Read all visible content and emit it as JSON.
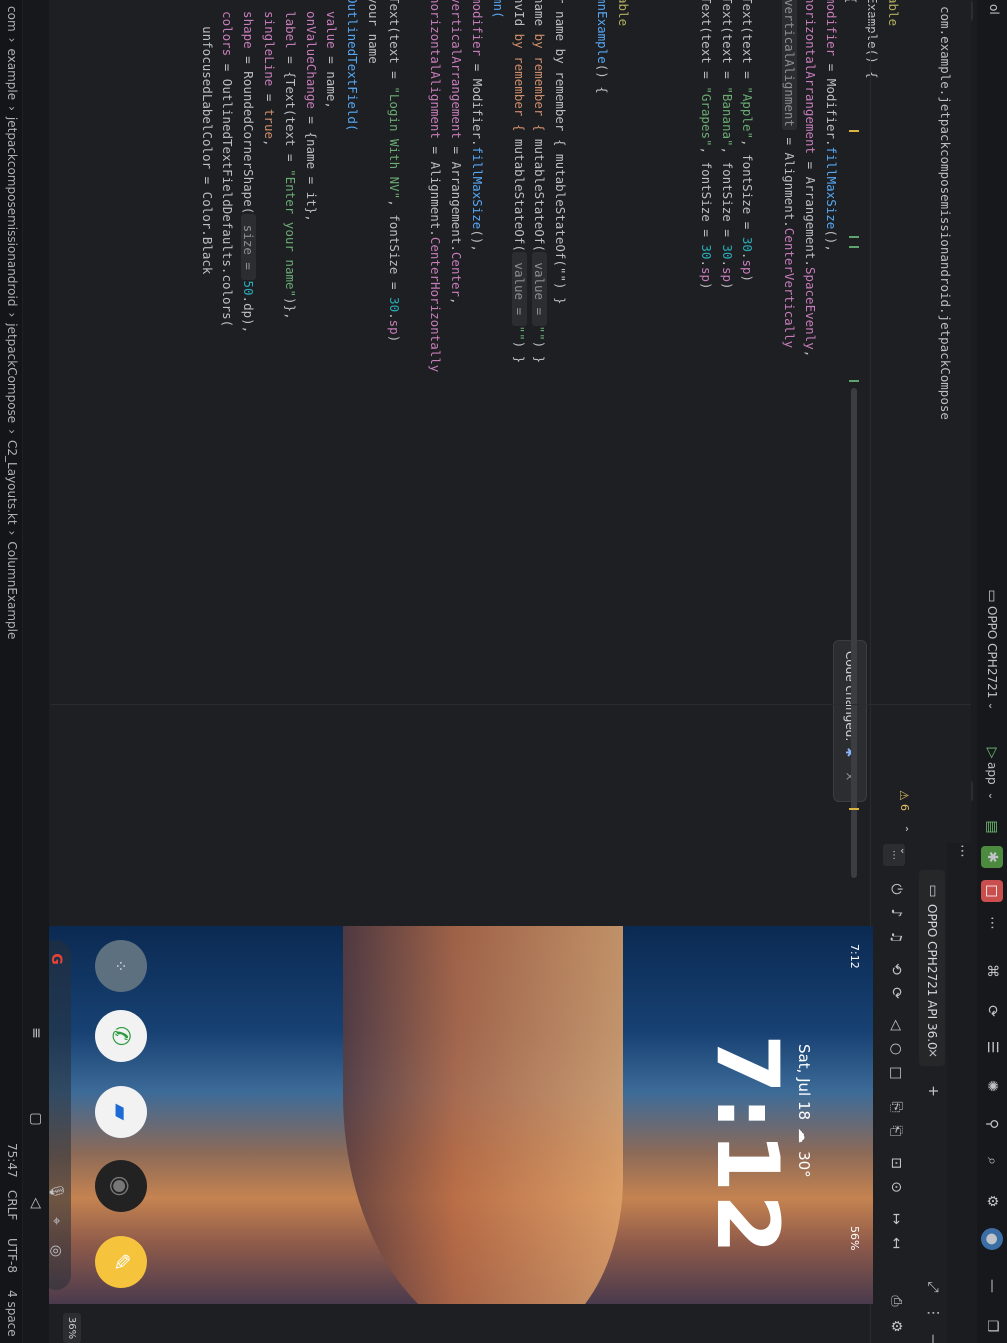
{
  "topbar": {
    "device_selector": "OPPO CPH2721",
    "run_config": "app",
    "left_title": "ol"
  },
  "editor": {
    "package_line": "com.example.jetpackcomposemissionandroid.jetpackCompose",
    "code_lines": [
      {
        "parts": [
          {
            "t": "able",
            "c": "ann"
          }
        ]
      },
      {
        "parts": [
          {
            "t": "Example() {",
            "c": "plain"
          }
        ]
      },
      {
        "parts": [
          {
            "t": "{",
            "c": "plain"
          }
        ]
      },
      {
        "parts": [
          {
            "t": "modifier",
            "c": "pm"
          },
          {
            "t": " = Modifier.",
            "c": "plain"
          },
          {
            "t": "fillMaxSize",
            "c": "fn"
          },
          {
            "t": "(),",
            "c": "plain"
          }
        ]
      },
      {
        "parts": [
          {
            "t": "horizontalArrangement",
            "c": "pm"
          },
          {
            "t": " = Arrangement.",
            "c": "plain"
          },
          {
            "t": "SpaceEvenly",
            "c": "pm"
          },
          {
            "t": ",",
            "c": "plain"
          }
        ]
      },
      {
        "parts": [
          {
            "t": "verticalAlignment",
            "c": "hint"
          },
          {
            "t": " = Alignment.",
            "c": "plain"
          },
          {
            "t": "CenterVertically",
            "c": "pm"
          }
        ]
      },
      {
        "parts": [
          {
            "t": "",
            "c": "plain"
          }
        ]
      },
      {
        "parts": [
          {
            "t": "Text(text = ",
            "c": "plain"
          },
          {
            "t": "\"Apple\"",
            "c": "str"
          },
          {
            "t": ", fontSize = ",
            "c": "plain"
          },
          {
            "t": "30",
            "c": "num"
          },
          {
            "t": ".",
            "c": "plain"
          },
          {
            "t": "sp",
            "c": "pm"
          },
          {
            "t": ")",
            "c": "plain"
          }
        ]
      },
      {
        "parts": [
          {
            "t": "Text(text = ",
            "c": "plain"
          },
          {
            "t": "\"Banana\"",
            "c": "str"
          },
          {
            "t": ", fontSize = ",
            "c": "plain"
          },
          {
            "t": "30",
            "c": "num"
          },
          {
            "t": ".",
            "c": "plain"
          },
          {
            "t": "sp",
            "c": "pm"
          },
          {
            "t": ")",
            "c": "plain"
          }
        ]
      },
      {
        "parts": [
          {
            "t": "Text(text = ",
            "c": "plain"
          },
          {
            "t": "\"Grapes\"",
            "c": "str"
          },
          {
            "t": ", fontSize = ",
            "c": "plain"
          },
          {
            "t": "30",
            "c": "num"
          },
          {
            "t": ".",
            "c": "plain"
          },
          {
            "t": "sp",
            "c": "pm"
          },
          {
            "t": ")",
            "c": "plain"
          }
        ]
      },
      {
        "parts": [
          {
            "t": "",
            "c": "plain"
          }
        ]
      },
      {
        "parts": [
          {
            "t": "",
            "c": "plain"
          }
        ]
      },
      {
        "parts": [
          {
            "t": "",
            "c": "plain"
          }
        ]
      },
      {
        "parts": [
          {
            "t": "able",
            "c": "ann"
          }
        ]
      },
      {
        "parts": [
          {
            "t": "mnExample",
            "c": "fn"
          },
          {
            "t": "() {",
            "c": "plain"
          }
        ]
      },
      {
        "parts": [
          {
            "t": "",
            "c": "plain"
          }
        ]
      },
      {
        "parts": [
          {
            "t": "r name by remember { mutableStateOf(\"\") }",
            "c": "plain"
          }
        ]
      },
      {
        "parts": [
          {
            "t": "name",
            "c": "plain"
          },
          {
            "t": " by remember { ",
            "c": "kw"
          },
          {
            "t": "mutableStateOf(",
            "c": "plain"
          },
          {
            "t": " value = ",
            "c": "hint"
          },
          {
            "t": "\"\"",
            "c": "str"
          },
          {
            "t": ") }",
            "c": "plain"
          }
        ]
      },
      {
        "parts": [
          {
            "t": "nvId",
            "c": "plain"
          },
          {
            "t": " by remember { ",
            "c": "kw"
          },
          {
            "t": "mutableStateOf(",
            "c": "plain"
          },
          {
            "t": " value = ",
            "c": "hint"
          },
          {
            "t": "\"\"",
            "c": "str"
          },
          {
            "t": ") }",
            "c": "plain"
          }
        ]
      },
      {
        "parts": [
          {
            "t": "mn(",
            "c": "fn"
          }
        ]
      },
      {
        "parts": [
          {
            "t": "modifier",
            "c": "pm"
          },
          {
            "t": " = Modifier.",
            "c": "plain"
          },
          {
            "t": "fillMaxSize",
            "c": "fn"
          },
          {
            "t": "(),",
            "c": "plain"
          }
        ]
      },
      {
        "parts": [
          {
            "t": "verticalArrangement",
            "c": "pm"
          },
          {
            "t": " = Arrangement.",
            "c": "plain"
          },
          {
            "t": "Center",
            "c": "pm"
          },
          {
            "t": ",",
            "c": "plain"
          }
        ]
      },
      {
        "parts": [
          {
            "t": "horizontalAlignment",
            "c": "pm"
          },
          {
            "t": " = Alignment.",
            "c": "plain"
          },
          {
            "t": "CenterHorizontally",
            "c": "pm"
          }
        ]
      },
      {
        "parts": [
          {
            "t": "",
            "c": "plain"
          }
        ]
      },
      {
        "parts": [
          {
            "t": "Text(text = ",
            "c": "plain"
          },
          {
            "t": "\"Login With NV\"",
            "c": "str"
          },
          {
            "t": ", fontSize = ",
            "c": "plain"
          },
          {
            "t": "30",
            "c": "num"
          },
          {
            "t": ".",
            "c": "plain"
          },
          {
            "t": "sp",
            "c": "pm"
          },
          {
            "t": ")",
            "c": "plain"
          }
        ]
      },
      {
        "parts": [
          {
            "t": "your name",
            "c": "plain"
          }
        ]
      },
      {
        "parts": [
          {
            "t": "OutlinedTextField(",
            "c": "fn"
          }
        ]
      },
      {
        "parts": [
          {
            "t": "  value",
            "c": "pm"
          },
          {
            "t": " = name,",
            "c": "plain"
          }
        ]
      },
      {
        "parts": [
          {
            "t": "  onValueChange",
            "c": "pm"
          },
          {
            "t": " = {name = it},",
            "c": "plain"
          }
        ]
      },
      {
        "parts": [
          {
            "t": "  label",
            "c": "pm"
          },
          {
            "t": " = {Text(text = ",
            "c": "plain"
          },
          {
            "t": "\"Enter your name\"",
            "c": "str"
          },
          {
            "t": ")},",
            "c": "plain"
          }
        ]
      },
      {
        "parts": [
          {
            "t": "  singleLine",
            "c": "pm"
          },
          {
            "t": " = ",
            "c": "plain"
          },
          {
            "t": "true",
            "c": "kw"
          },
          {
            "t": ",",
            "c": "plain"
          }
        ]
      },
      {
        "parts": [
          {
            "t": "  shape",
            "c": "pm"
          },
          {
            "t": " = RoundedCornerShape(",
            "c": "plain"
          },
          {
            "t": " size = ",
            "c": "hint"
          },
          {
            "t": "50",
            "c": "num"
          },
          {
            "t": ".dp),",
            "c": "plain"
          }
        ]
      },
      {
        "parts": [
          {
            "t": "  colors",
            "c": "pm"
          },
          {
            "t": " = OutlinedTextFieldDefaults.colors(",
            "c": "plain"
          }
        ]
      },
      {
        "parts": [
          {
            "t": "    unfocusedLabelColor = Color.Black",
            "c": "plain"
          }
        ]
      }
    ],
    "toast": "Code changed:",
    "problems": "6"
  },
  "breadcrumb": [
    "com",
    "example",
    "jetpackcomposemissionandroid",
    "jetpackCompose",
    "C2_Layouts.kt",
    "ColumnExample"
  ],
  "status": {
    "position": "75:47",
    "line_sep": "CRLF",
    "encoding": "UTF-8",
    "indent": "4 space"
  },
  "emulator": {
    "tab_label": "OPPO CPH2721 API 36.0",
    "zoom": "36%",
    "phone_time": "7:12",
    "clock": "7:12",
    "date": "Sat, Jul 18",
    "weather": "30°",
    "battery": "56%"
  }
}
